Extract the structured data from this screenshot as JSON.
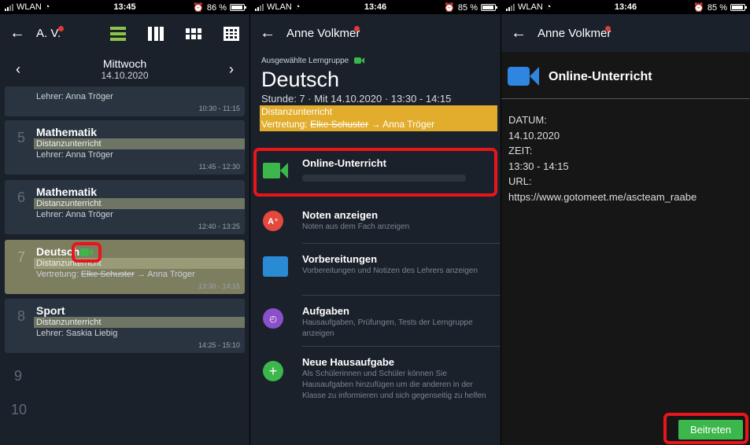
{
  "panel1": {
    "status": {
      "carrier": "WLAN",
      "time": "13:45",
      "battery": "86 %"
    },
    "nav_title": "A. V.",
    "date_bar": {
      "day": "Mittwoch",
      "date": "14.10.2020"
    },
    "partial_lesson": {
      "teacher": "Lehrer: Anna Tröger",
      "time": "10:30 - 11:15"
    },
    "lessons": [
      {
        "num": "5",
        "subject": "Mathematik",
        "band": "Distanzunterricht",
        "sub": "Lehrer: Anna Tröger",
        "time": "11:45 - 12:30"
      },
      {
        "num": "6",
        "subject": "Mathematik",
        "band": "Distanzunterricht",
        "sub": "Lehrer: Anna Tröger",
        "time": "12:40 - 13:25"
      },
      {
        "num": "7",
        "subject": "Deutsch",
        "band": "Distanzunterricht",
        "sub_prefix": "Vertretung:",
        "sub_strike": "Elke Schuster",
        "sub_suffix": "→ Anna Tröger",
        "time": "13:30 - 14:15"
      },
      {
        "num": "8",
        "subject": "Sport",
        "band": "Distanzunterricht",
        "sub": "Lehrer: Saskia Liebig",
        "time": "14:25 - 15:10"
      }
    ],
    "empty_nums": [
      "9",
      "10"
    ]
  },
  "panel2": {
    "status": {
      "carrier": "WLAN",
      "time": "13:46",
      "battery": "85 %"
    },
    "nav_title": "Anne Volkmer",
    "group_label": "Ausgewählte Lerngruppe",
    "subject": "Deutsch",
    "meta": "Stunde: 7 · Mit 14.10.2020 · 13:30 - 14:15",
    "notice_1": "Distanzunterricht",
    "notice_2_prefix": "Vertretung:",
    "notice_2_strike": "Elke Schuster",
    "notice_2_suffix": "→ Anna Tröger",
    "items": [
      {
        "title": "Online-Unterricht",
        "desc": ""
      },
      {
        "title": "Noten anzeigen",
        "desc": "Noten aus dem Fach anzeigen"
      },
      {
        "title": "Vorbereitungen",
        "desc": "Vorbereitungen und Notizen des Lehrers anzeigen"
      },
      {
        "title": "Aufgaben",
        "desc": "Hausaufgaben, Prüfungen, Tests der Lerngruppe anzeigen"
      },
      {
        "title": "Neue Hausaufgabe",
        "desc": "Als Schülerinnen und Schüler können Sie Hausaufgaben hinzufügen um die anderen in der Klasse zu informieren und sich gegenseitig zu helfen"
      }
    ]
  },
  "panel3": {
    "status": {
      "carrier": "WLAN",
      "time": "13:46",
      "battery": "85 %"
    },
    "nav_title": "Anne Volkmer",
    "title": "Online-Unterricht",
    "datum_label": "DATUM:",
    "datum": "14.10.2020",
    "zeit_label": "ZEIT:",
    "zeit": "13:30 - 14:15",
    "url_label": "URL:",
    "url": "https://www.gotomeet.me/ascteam_raabe",
    "join_label": "Beitreten"
  },
  "colors": {
    "accent_green": "#3cb74b",
    "highlight_red": "#e8151b",
    "notice_yellow": "#e2ad2c",
    "notification_dot": "#e53935"
  },
  "battery_levels": {
    "panel1": 0.86,
    "panel2": 0.85,
    "panel3": 0.85
  }
}
